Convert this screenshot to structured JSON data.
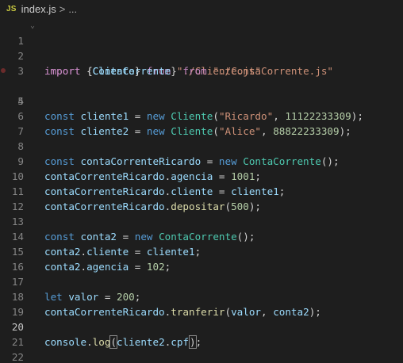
{
  "breadcrumb": {
    "icon_label": "JS",
    "file_name": "index.js",
    "separator": ">",
    "more": "..."
  },
  "line_numbers": [
    "1",
    "2",
    "3",
    "4",
    "5",
    "6",
    "7",
    "8",
    "9",
    "10",
    "11",
    "12",
    "13",
    "14",
    "15",
    "16",
    "17",
    "18",
    "19",
    "20",
    "21",
    "22"
  ],
  "code": {
    "l1": {
      "kw": "import",
      "open": " {",
      "name": "Cliente",
      "close": "} ",
      "from": "from",
      "sp": " ",
      "path": "\"./Cliente.js\""
    },
    "l2": {
      "kw": "import",
      "open": " {",
      "name": "ContaCorrente",
      "close": "} ",
      "from": "from",
      "sp": " ",
      "path": "\"./ContaCorrente.js\""
    },
    "l4": {
      "kw": "const",
      "var": " cliente1",
      "eq": " = ",
      "new": "new",
      "cls": " Cliente",
      "p1": "(",
      "s1": "\"Ricardo\"",
      "comma": ", ",
      "num": "11122233309",
      "p2": ");"
    },
    "l6": {
      "kw": "const",
      "var": " cliente2",
      "eq": " = ",
      "new": "new",
      "cls": " Cliente",
      "p1": "(",
      "s1": "\"Alice\"",
      "comma": ", ",
      "num": "88822233309",
      "p2": ");"
    },
    "l8": {
      "kw": "const",
      "var": " contaCorrenteRicardo",
      "eq": " = ",
      "new": "new",
      "cls": " ContaCorrente",
      "p": "();"
    },
    "l9": {
      "obj": "contaCorrenteRicardo",
      "dot": ".",
      "prop": "agencia",
      "eq": " = ",
      "num": "1001",
      "end": ";"
    },
    "l10": {
      "obj": "contaCorrenteRicardo",
      "dot": ".",
      "prop": "cliente",
      "eq": " = ",
      "val": "cliente1",
      "end": ";"
    },
    "l11": {
      "obj": "contaCorrenteRicardo",
      "dot": ".",
      "fn": "depositar",
      "p1": "(",
      "num": "500",
      "p2": ");"
    },
    "l13": {
      "kw": "const",
      "var": " conta2",
      "eq": " = ",
      "new": "new",
      "cls": " ContaCorrente",
      "p": "();"
    },
    "l14": {
      "obj": "conta2",
      "dot": ".",
      "prop": "cliente",
      "eq": " = ",
      "val": "cliente1",
      "end": ";"
    },
    "l15": {
      "obj": "conta2",
      "dot": ".",
      "prop": "agencia",
      "eq": " = ",
      "num": "102",
      "end": ";"
    },
    "l17": {
      "kw": "let",
      "var": " valor",
      "eq": " = ",
      "num": "200",
      "end": ";"
    },
    "l18": {
      "obj": "contaCorrenteRicardo",
      "dot": ".",
      "fn": "tranferir",
      "p1": "(",
      "a1": "valor",
      "comma": ", ",
      "a2": "conta2",
      "p2": ");"
    },
    "l20": {
      "obj": "console",
      "dot": ".",
      "fn": "log",
      "p1": "(",
      "a1": "cliente2",
      "dot2": ".",
      "prop": "cpf",
      "p2": ")",
      "end": ";"
    }
  },
  "colors": {
    "background": "#1e1e1e",
    "keyword": "#569cd6",
    "control_keyword": "#c586c0",
    "variable": "#9cdcfe",
    "class": "#4ec9b0",
    "string": "#ce9178",
    "number": "#b5cea8",
    "function": "#dcdcaa"
  },
  "icons": {
    "file_icon": "javascript-file-icon",
    "fold": "chevron-down-icon",
    "breakpoint": "breakpoint-hint-icon"
  }
}
